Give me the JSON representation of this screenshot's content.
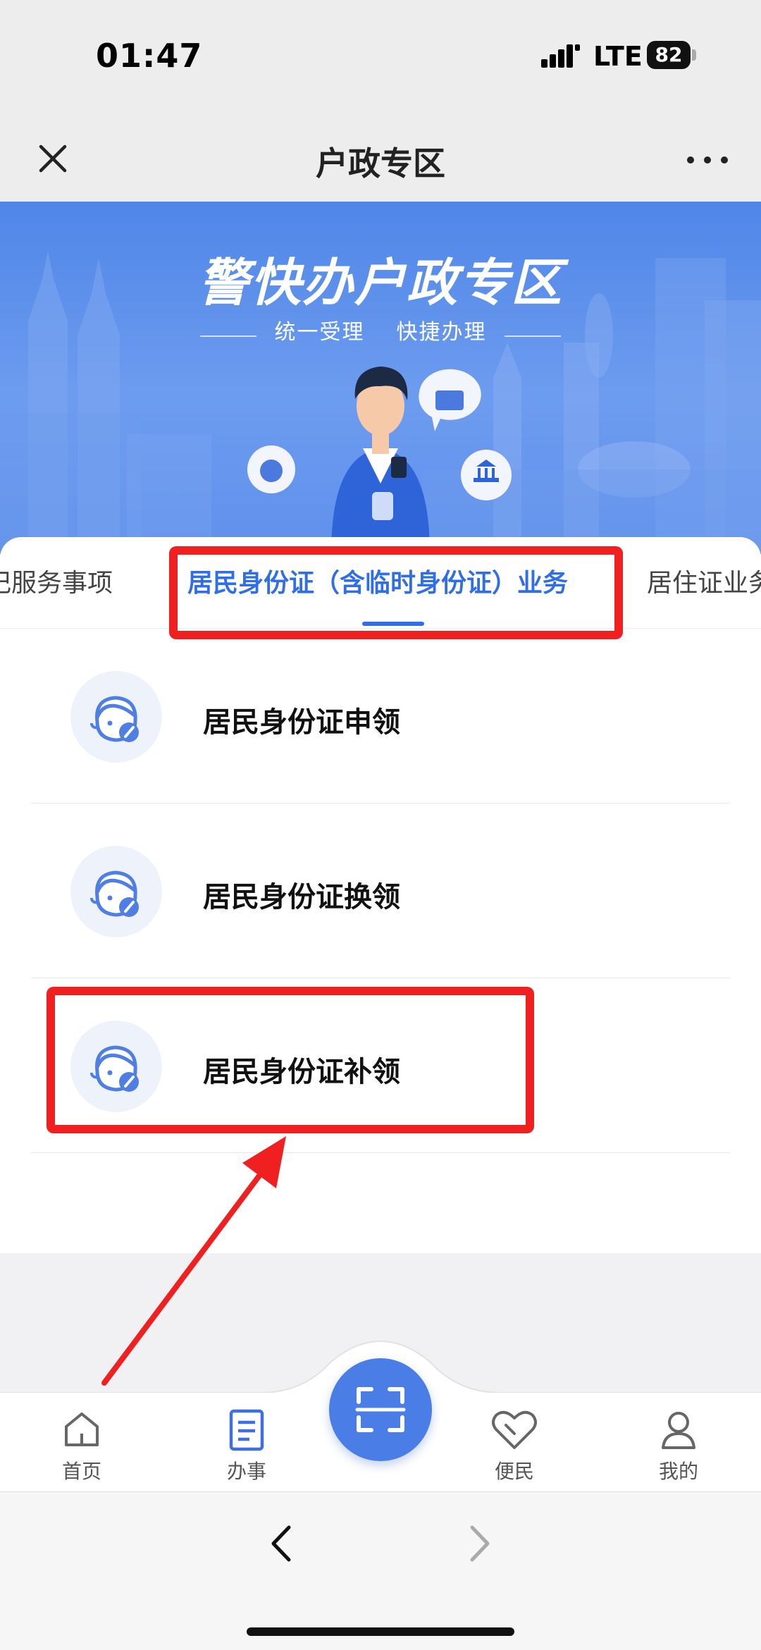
{
  "status_bar": {
    "time": "01:47",
    "network": "LTE",
    "battery": "82"
  },
  "nav": {
    "title": "户政专区"
  },
  "banner": {
    "title": "警快办户政专区",
    "subtitle_1": "统一受理",
    "subtitle_2": "快捷办理"
  },
  "tabs": [
    {
      "label": "记服务事项"
    },
    {
      "label": "居民身份证（含临时身份证）业务"
    },
    {
      "label": "居住证业务"
    }
  ],
  "services": [
    {
      "label": "居民身份证申领"
    },
    {
      "label": "居民身份证换领"
    },
    {
      "label": "居民身份证补领"
    }
  ],
  "tabbar": {
    "home": "首页",
    "work": "办事",
    "convenience": "便民",
    "mine": "我的"
  },
  "colors": {
    "primary": "#2f6ee6",
    "annotation": "#f02020",
    "banner": "#5b8de9"
  }
}
